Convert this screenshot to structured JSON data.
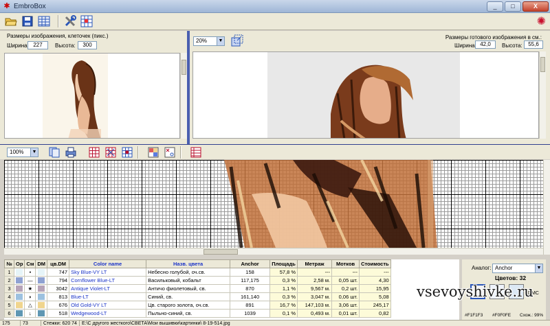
{
  "window": {
    "title": "EmbroBox",
    "minimize": "_",
    "maximize": "□",
    "close": "X"
  },
  "toolbar": {
    "icons": [
      "open-folder-icon",
      "save-icon",
      "palette-table-icon",
      "tools-icon",
      "settings-grid-icon"
    ],
    "logo": "embrobox-logo"
  },
  "left_panel": {
    "heading": "Размеры изображения, клеточек (пикс.)",
    "width_label": "Ширина:",
    "width_value": "227",
    "height_label": "Высота:",
    "height_value": "300"
  },
  "right_panel": {
    "zoom": "20%",
    "heading": "Размеры готового изображения в см.:",
    "width_label": "Ширина:",
    "width_value": "42,0",
    "height_label": "Высота:",
    "height_value": "55,6"
  },
  "pattern_toolbar": {
    "zoom": "100%"
  },
  "table": {
    "headers": [
      "№",
      "Ор",
      "См",
      "DM",
      "цв.DM",
      "Color name",
      "Назв. цвета",
      "Anchor",
      "Площадь",
      "Метраж",
      "Мотков",
      "Стоимость"
    ],
    "rows": [
      {
        "no": "1",
        "sym": "•",
        "dm": "747",
        "name": "Sky Blue-VY LT",
        "rus": "Небесно голубой, оч.св.",
        "anchor": "158",
        "area": "57,8 %",
        "meters": "---",
        "skeins": "---",
        "cost": "---",
        "color": "#e6f4f8"
      },
      {
        "no": "2",
        "sym": "—",
        "dm": "794",
        "name": "Cornflower Blue-LT",
        "rus": "Васильковый, кобальт",
        "anchor": "117,175",
        "area": "0,3 %",
        "meters": "2,58 м.",
        "skeins": "0,05 шт.",
        "cost": "4,30",
        "color": "#8fa2d2"
      },
      {
        "no": "3",
        "sym": "★",
        "dm": "3042",
        "name": "Antique Violet-LT",
        "rus": "Античо фиолетовый, св.",
        "anchor": "870",
        "area": "1,1 %",
        "meters": "9,567 м.",
        "skeins": "0,2 шт.",
        "cost": "15,95",
        "color": "#b7a4b8"
      },
      {
        "no": "4",
        "sym": "◗",
        "dm": "813",
        "name": "Blue-LT",
        "rus": "Синий, св.",
        "anchor": "161,140",
        "area": "0,3 %",
        "meters": "3,047 м.",
        "skeins": "0,06 шт.",
        "cost": "5,08",
        "color": "#9cc1df"
      },
      {
        "no": "5",
        "sym": "△",
        "dm": "676",
        "name": "Old Gold-VY LT",
        "rus": "Цв. старого золота, оч.св.",
        "anchor": "891",
        "area": "16,7 %",
        "meters": "147,103 м.",
        "skeins": "3,06 шт.",
        "cost": "245,17",
        "color": "#f0d58e"
      },
      {
        "no": "6",
        "sym": "↓",
        "dm": "518",
        "name": "Wedgewood-LT",
        "rus": "Пыльно-синий, св.",
        "anchor": "1039",
        "area": "0,1 %",
        "meters": "0,493 м.",
        "skeins": "0,01 шт.",
        "cost": "0,82",
        "color": "#5f97b3"
      }
    ]
  },
  "side_panel": {
    "analog_label": "Аналог:",
    "analog_value": "Anchor",
    "colors_label": "Цветов: 32",
    "swatch1_hex": "#F1F1F3",
    "swatch2_hex": "#F0F0FE",
    "similarity": "Схож.: 99%",
    "dmc_label": "DMC"
  },
  "status": {
    "x": "175",
    "y": "73",
    "info": "Стежки: 620 74",
    "path": "E:\\С другого жесткого\\СВЕТА\\Мои вышивки\\картинки\\ 8-19-514.jpg"
  },
  "watermark": "vsevoyshivke.ru"
}
